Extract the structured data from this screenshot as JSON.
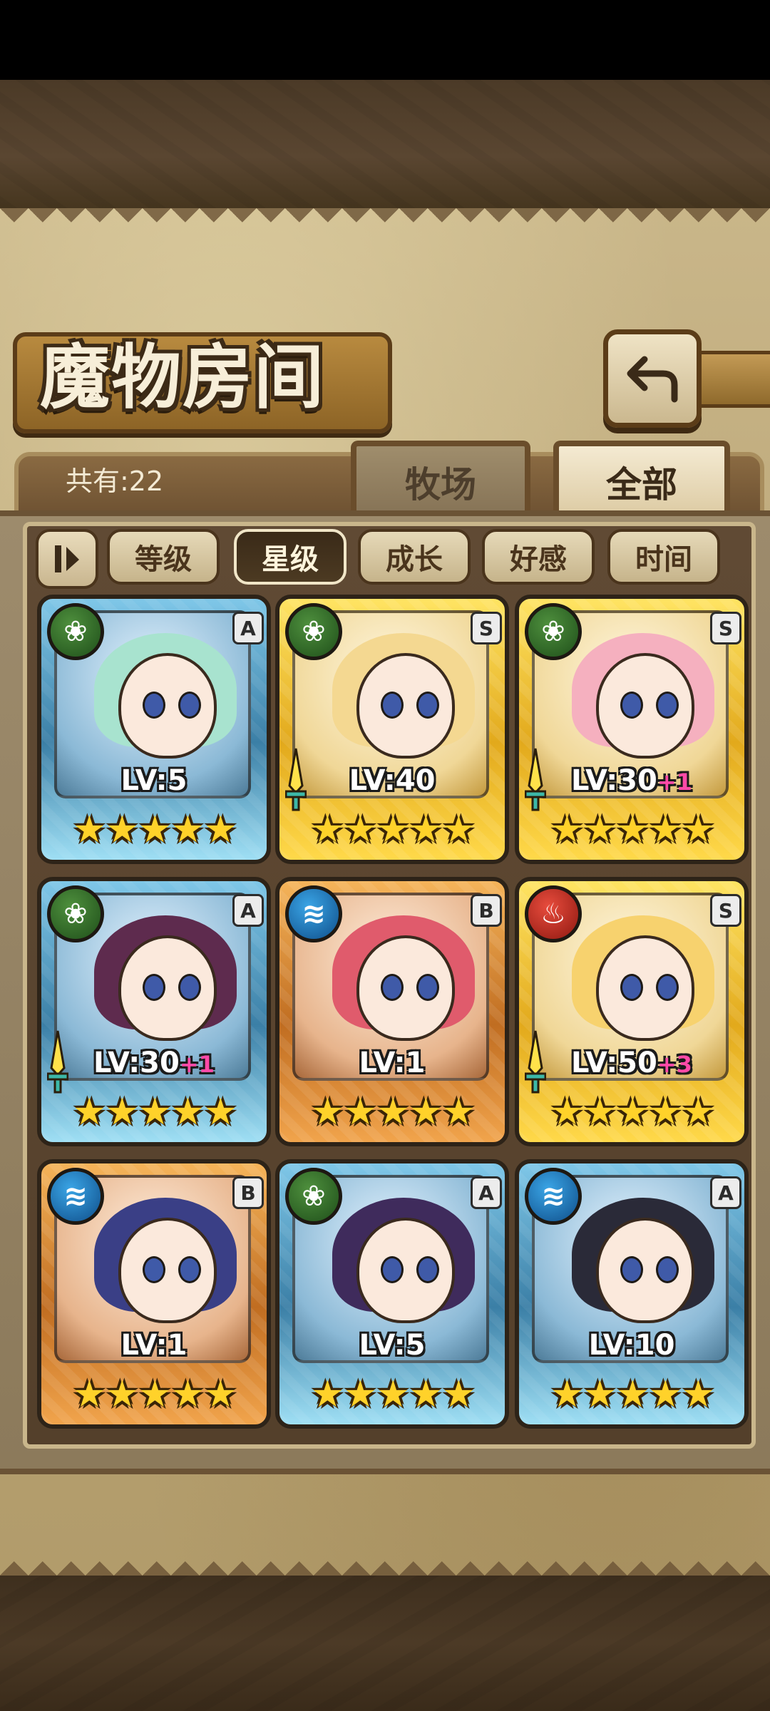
{
  "header": {
    "title": "魔物房间",
    "back_icon": "back-arrow-icon"
  },
  "tabs": [
    {
      "label": "牧场",
      "active": false
    },
    {
      "label": "全部",
      "active": true
    }
  ],
  "count_label": "共有:22",
  "sort": {
    "toggle_icon": "sort-order-icon",
    "buttons": [
      {
        "label": "等级",
        "active": false
      },
      {
        "label": "星级",
        "active": true
      },
      {
        "label": "成长",
        "active": false
      },
      {
        "label": "好感",
        "active": false
      },
      {
        "label": "时间",
        "active": false
      }
    ]
  },
  "monsters": [
    {
      "frame": "blue",
      "element": "nature",
      "rank": "A",
      "level": "LV:5",
      "plus": "",
      "sword": false,
      "stars": 5,
      "hair": "#a8e3cf"
    },
    {
      "frame": "gold",
      "element": "nature",
      "rank": "S",
      "level": "LV:40",
      "plus": "",
      "sword": true,
      "stars": 5,
      "hair": "#f4d891"
    },
    {
      "frame": "gold",
      "element": "nature",
      "rank": "S",
      "level": "LV:30",
      "plus": "+1",
      "sword": true,
      "stars": 5,
      "hair": "#f5b0bf"
    },
    {
      "frame": "blue",
      "element": "nature",
      "rank": "A",
      "level": "LV:30",
      "plus": "+1",
      "sword": true,
      "stars": 5,
      "hair": "#5e2b4e"
    },
    {
      "frame": "orange",
      "element": "water",
      "rank": "B",
      "level": "LV:1",
      "plus": "",
      "sword": false,
      "stars": 5,
      "hair": "#e05b6c"
    },
    {
      "frame": "gold",
      "element": "fire",
      "rank": "S",
      "level": "LV:50",
      "plus": "+3",
      "sword": true,
      "stars": 5,
      "hair": "#f7d26e"
    },
    {
      "frame": "orange",
      "element": "water",
      "rank": "B",
      "level": "LV:1",
      "plus": "",
      "sword": false,
      "stars": 5,
      "hair": "#3a3f86"
    },
    {
      "frame": "blue",
      "element": "nature",
      "rank": "A",
      "level": "LV:5",
      "plus": "",
      "sword": false,
      "stars": 5,
      "hair": "#3f2b5c"
    },
    {
      "frame": "blue",
      "element": "water",
      "rank": "A",
      "level": "LV:10",
      "plus": "",
      "sword": false,
      "stars": 5,
      "hair": "#2a2a38"
    }
  ]
}
